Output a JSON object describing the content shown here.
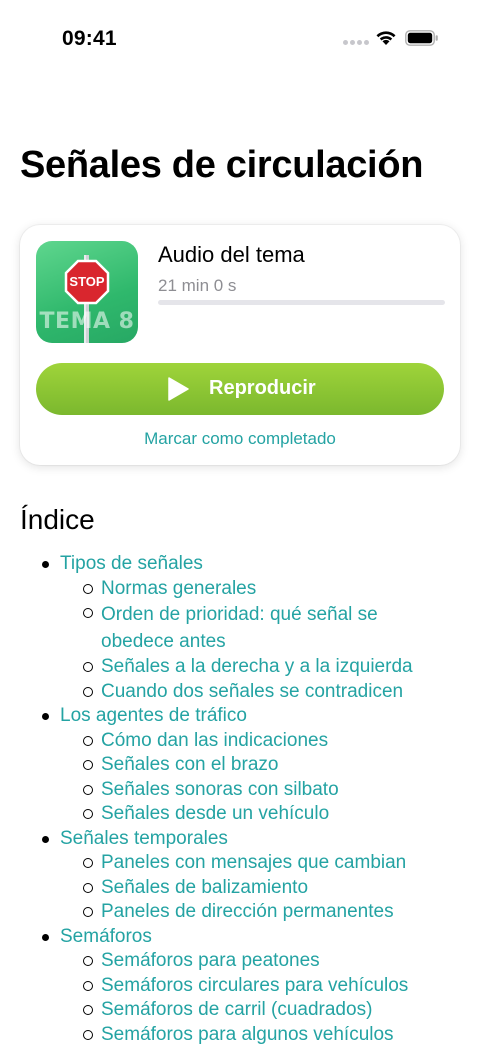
{
  "status": {
    "time": "09:41"
  },
  "page": {
    "title": "Señales de circulación"
  },
  "player": {
    "cover_label": "TEMA 8",
    "cover_sign_text": "STOP",
    "title": "Audio del tema",
    "duration": "21 min 0 s",
    "progress": 0,
    "play_label": "Reproducir",
    "mark_complete": "Marcar como completado",
    "accent": "#8bc53f",
    "link_color": "#24a3a3"
  },
  "index": {
    "heading": "Índice",
    "sections": [
      {
        "label": "Tipos de señales",
        "items": [
          "Normas generales",
          "Orden de prioridad: qué señal se obedece antes",
          "Señales a la derecha y a la izquierda",
          "Cuando dos señales se contradicen"
        ]
      },
      {
        "label": "Los agentes de tráfico",
        "items": [
          "Cómo dan las indicaciones",
          "Señales con el brazo",
          "Señales sonoras con silbato",
          "Señales desde un vehículo"
        ]
      },
      {
        "label": "Señales temporales",
        "items": [
          "Paneles con mensajes que cambian",
          "Señales de balizamiento",
          "Paneles de dirección permanentes"
        ]
      },
      {
        "label": "Semáforos",
        "items": [
          "Semáforos para peatones",
          "Semáforos circulares para vehículos",
          "Semáforos de carril (cuadrados)",
          "Semáforos para algunos vehículos"
        ]
      }
    ]
  }
}
